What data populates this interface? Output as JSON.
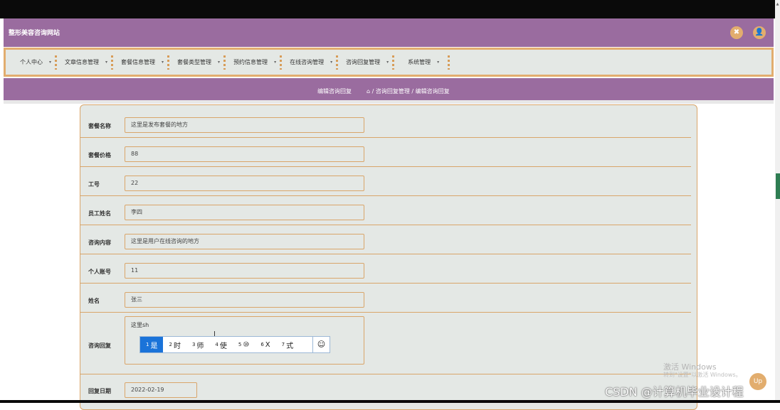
{
  "header": {
    "site_title": "整形美容咨询网站",
    "close_icon": "✖",
    "user_icon": "👤"
  },
  "nav": {
    "items": [
      {
        "label": "个人中心"
      },
      {
        "label": "文章信息管理"
      },
      {
        "label": "套餐信息管理"
      },
      {
        "label": "套餐类型管理"
      },
      {
        "label": "预约信息管理"
      },
      {
        "label": "在线咨询管理"
      },
      {
        "label": "咨询回复管理"
      },
      {
        "label": "系统管理"
      }
    ],
    "caret": "▾"
  },
  "breadcrumb": {
    "title": "编辑咨询回复",
    "home_icon": "⌂",
    "path": " / 咨询回复管理 / 编辑咨询回复"
  },
  "form": {
    "fields": [
      {
        "label": "套餐名称",
        "value": "这里是发布套餐的地方"
      },
      {
        "label": "套餐价格",
        "value": "88"
      },
      {
        "label": "工号",
        "value": "22"
      },
      {
        "label": "员工姓名",
        "value": "李四"
      },
      {
        "label": "咨询内容",
        "value": "这里是用户在线咨询的地方"
      },
      {
        "label": "个人账号",
        "value": "11"
      },
      {
        "label": "姓名",
        "value": "张三"
      }
    ],
    "reply": {
      "label": "咨询回复",
      "value": "这里sh"
    },
    "date": {
      "label": "回复日期",
      "value": "2022-02-19"
    }
  },
  "ime": {
    "candidates": [
      {
        "num": "1",
        "text": "是"
      },
      {
        "num": "2",
        "text": "时"
      },
      {
        "num": "3",
        "text": "师"
      },
      {
        "num": "4",
        "text": "使"
      },
      {
        "num": "5",
        "text": "⑩"
      },
      {
        "num": "6",
        "text": "X"
      },
      {
        "num": "7",
        "text": "式"
      }
    ],
    "emoji": "☺"
  },
  "overlay": {
    "activate_title": "激活 Windows",
    "activate_hint": "转到\"设置\"以激活 Windows。",
    "csdn": "CSDN @计算机毕业设计程",
    "fab": "Up"
  }
}
